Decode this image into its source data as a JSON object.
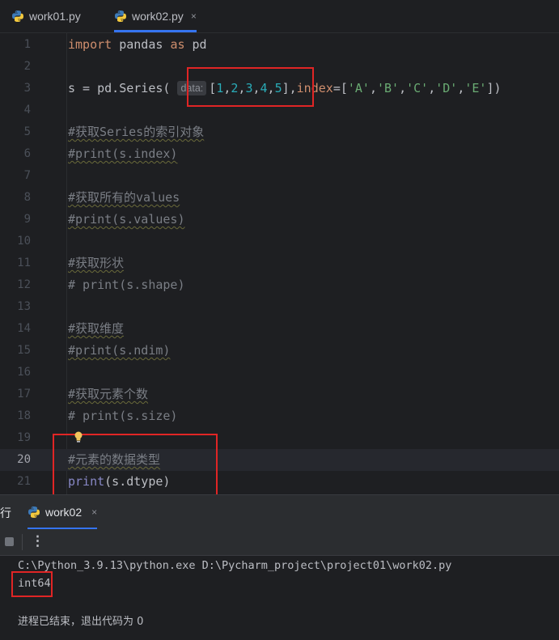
{
  "tabs": [
    {
      "label": "work01.py",
      "active": false
    },
    {
      "label": "work02.py",
      "active": true,
      "close": "×"
    }
  ],
  "editor": {
    "current_line": 20,
    "lines": [
      {
        "n": "1"
      },
      {
        "n": "2"
      },
      {
        "n": "3"
      },
      {
        "n": "4"
      },
      {
        "n": "5"
      },
      {
        "n": "6"
      },
      {
        "n": "7"
      },
      {
        "n": "8"
      },
      {
        "n": "9"
      },
      {
        "n": "10"
      },
      {
        "n": "11"
      },
      {
        "n": "12"
      },
      {
        "n": "13"
      },
      {
        "n": "14"
      },
      {
        "n": "15"
      },
      {
        "n": "16"
      },
      {
        "n": "17"
      },
      {
        "n": "18"
      },
      {
        "n": "19"
      },
      {
        "n": "20"
      },
      {
        "n": "21"
      }
    ],
    "code": {
      "l1_import": "import",
      "l1_mod": " pandas ",
      "l1_as": "as",
      "l1_alias": " pd",
      "l3_pre": "s = pd.Series( ",
      "l3_hint": "data:",
      "l3_list": [
        "1",
        "2",
        "3",
        "4",
        "5"
      ],
      "l3_param": "index",
      "l3_strs": [
        "'A'",
        "'B'",
        "'C'",
        "'D'",
        "'E'"
      ],
      "l5": "#获取Series的索引对象",
      "l6": "#print(s.index)",
      "l8": "#获取所有的values",
      "l9": "#print(s.values)",
      "l11": "#获取形状",
      "l12": "# print(s.shape)",
      "l14": "#获取维度",
      "l15": "#print(s.ndim)",
      "l17": "#获取元素个数",
      "l18": "# print(s.size)",
      "l20": "#元素的数据类型",
      "l21_fn": "print",
      "l21_rest": "(s.dtype)"
    }
  },
  "run_panel": {
    "label": "行",
    "tab_label": "work02",
    "tab_close": "×",
    "kebab": "⋮"
  },
  "console": {
    "cmd": "C:\\Python_3.9.13\\python.exe D:\\Pycharm_project\\project01\\work02.py",
    "output": "int64",
    "exit": "进程已结束，退出代码为 0"
  }
}
